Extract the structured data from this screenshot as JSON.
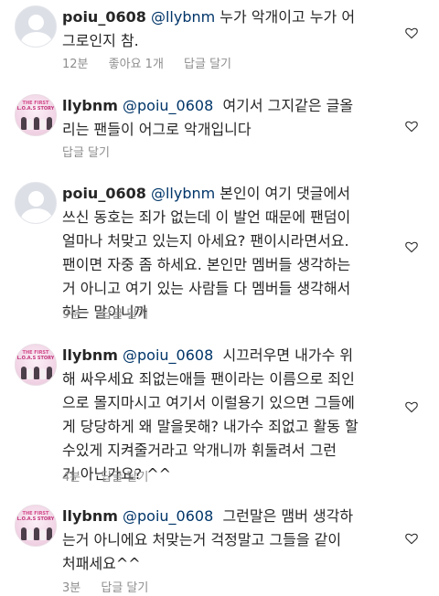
{
  "comments": [
    {
      "username": "poiu_0608",
      "mention": "@llybnm",
      "lines": [
        "누가 악개이고 누가 어",
        "그로인지 참."
      ],
      "time": "12분",
      "likes": "좋아요 1개",
      "reply": "답글 달기",
      "avatar": "default-profile-icon"
    },
    {
      "username": "llybnm",
      "mention": "@poiu_0608",
      "lines": [
        "여기서 그지같은 글올",
        "리는  팬들이 어그로 악개입니다"
      ],
      "reply": "답글 달기",
      "avatar": "group-photo-avatar",
      "avatar_text": [
        "THE FIRST",
        "L.O.A.S STORY"
      ]
    },
    {
      "username": "poiu_0608",
      "mention": "@llybnm",
      "lines": [
        "본인이 여기 댓글에서",
        "쓰신 동호는 죄가 없는데 이 발언 때문에 팬덤이",
        "얼마나 처맞고 있는지 아세요? 팬이시라면서요.",
        "팬이면 자중 좀 하세요. 본인만 멤버들 생각하는",
        "거 아니고 여기 있는 사람들 다 멤버들 생각해서",
        "하는 말이니까"
      ],
      "time": "9분",
      "reply": "답글 달기",
      "avatar": "default-profile-icon"
    },
    {
      "username": "llybnm",
      "mention": "@poiu_0608",
      "lines": [
        "시끄러우면 내가수 위",
        "해 싸우세요 죄없는애들 팬이라는 이름으로 죄인",
        "으로 몰지마시고 여기서 이럴용기 있으면 그들에",
        "게 당당하게 왜 말을못해? 내가수 죄없고 활동 할",
        "수있게 지켜줄거라고  악개니까  휘둘려서 그런",
        "거 아닌가요? ^^"
      ],
      "time": "4분",
      "reply": "답글 달기",
      "avatar": "group-photo-avatar",
      "avatar_text": [
        "THE FIRST",
        "L.O.A.S STORY"
      ]
    },
    {
      "username": "llybnm",
      "mention": "@poiu_0608",
      "lines": [
        "그런말은 맴버 생각하",
        "는거 아니에요 처맞는거 걱정말고 그들을 같이",
        "처패세요^^"
      ],
      "time": "3분",
      "reply": "답글 달기",
      "avatar": "group-photo-avatar",
      "avatar_text": [
        "THE FIRST",
        "L.O.A.S STORY"
      ]
    }
  ],
  "colors": {
    "text": "#262626",
    "mention": "#003569",
    "meta": "#8e8e8e"
  },
  "icons": {
    "like": "heart-outline-icon"
  }
}
